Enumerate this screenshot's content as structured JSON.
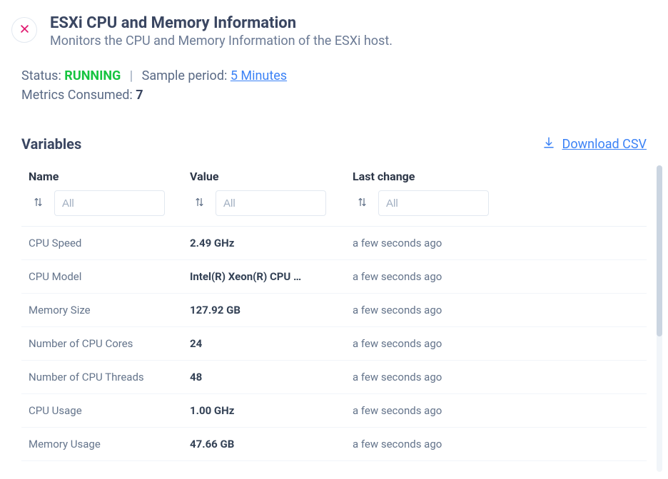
{
  "header": {
    "title": "ESXi CPU and Memory Information",
    "subtitle": "Monitors the CPU and Memory Information of the ESXi host."
  },
  "status": {
    "label": "Status: ",
    "value": "RUNNING",
    "separator": "|",
    "sample_label": "Sample period: ",
    "sample_value": "5 Minutes"
  },
  "metrics": {
    "label": "Metrics Consumed: ",
    "value": "7"
  },
  "section": {
    "title": "Variables",
    "download": "Download CSV"
  },
  "columns": {
    "name": "Name",
    "value": "Value",
    "last": "Last change",
    "filter_placeholder": "All"
  },
  "rows": [
    {
      "name": "CPU Speed",
      "value": "2.49 GHz",
      "last": "a few seconds ago"
    },
    {
      "name": "CPU Model",
      "value": "Intel(R) Xeon(R) CPU …",
      "last": "a few seconds ago"
    },
    {
      "name": "Memory Size",
      "value": "127.92 GB",
      "last": "a few seconds ago"
    },
    {
      "name": "Number of CPU Cores",
      "value": "24",
      "last": "a few seconds ago"
    },
    {
      "name": "Number of CPU Threads",
      "value": "48",
      "last": "a few seconds ago"
    },
    {
      "name": "CPU Usage",
      "value": "1.00 GHz",
      "last": "a few seconds ago"
    },
    {
      "name": "Memory Usage",
      "value": "47.66 GB",
      "last": "a few seconds ago"
    }
  ]
}
